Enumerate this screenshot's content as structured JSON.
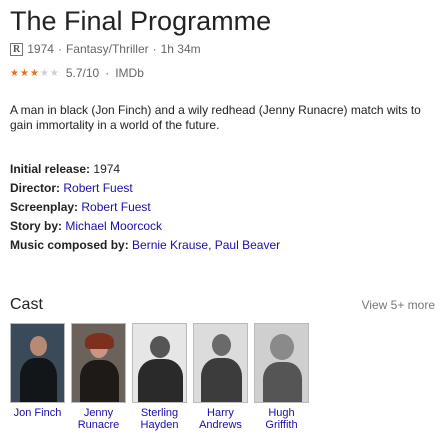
{
  "title": "The Final Programme",
  "meta": {
    "rating_badge": "R",
    "year": "1974",
    "genre": "Fantasy/Thriller",
    "duration": "1h 34m",
    "separator": "·"
  },
  "score": {
    "stars_value": 2.85,
    "stars_max": 5,
    "text": "5.7/10",
    "source": "IMDb"
  },
  "description": "A man in black (Jon Finch) and a wily redhead (Jenny Runacre) match wits to gain immortality in a world of the future.",
  "facts": {
    "release": {
      "label": "Initial release:",
      "value": "1974"
    },
    "director": {
      "label": "Director:",
      "value": "Robert Fuest"
    },
    "screenplay": {
      "label": "Screenplay:",
      "value": "Robert Fuest"
    },
    "story": {
      "label": "Story by:",
      "value": "Michael Moorcock"
    },
    "music": {
      "label": "Music composed by:",
      "value1": "Bernie Krause",
      "sep": ", ",
      "value2": "Paul Beaver"
    }
  },
  "cast_section": {
    "title": "Cast",
    "view_more": "View 5+ more",
    "members": [
      {
        "line1": "Jon Finch",
        "line2": ""
      },
      {
        "line1": "Jenny",
        "line2": "Runacre"
      },
      {
        "line1": "Sterling",
        "line2": "Hayden"
      },
      {
        "line1": "Harry",
        "line2": "Andrews"
      },
      {
        "line1": "Hugh",
        "line2": "Griffith"
      }
    ]
  },
  "colors": {
    "link": "#1a0dab",
    "star": "#e7711b",
    "muted": "#666666"
  },
  "icons": [
    "star-icon",
    "rating-badge-icon"
  ]
}
